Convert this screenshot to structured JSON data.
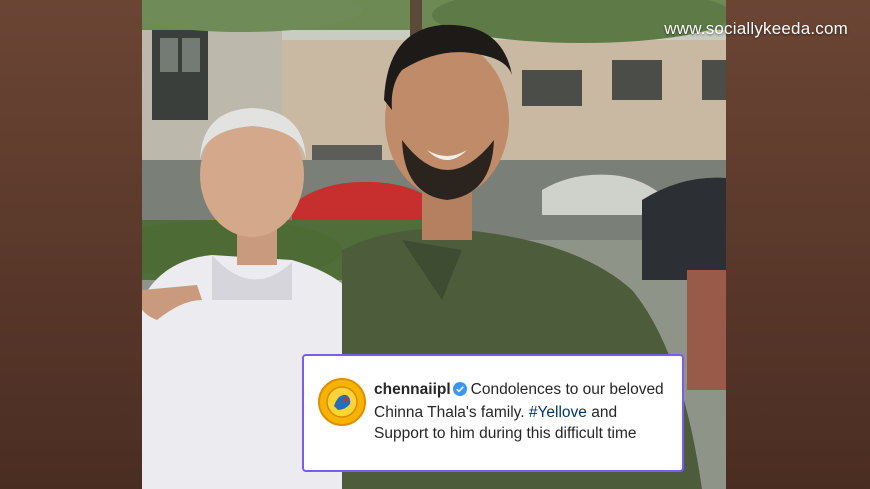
{
  "watermark": "www.sociallykeeda.com",
  "post": {
    "username": "chennaiipl",
    "caption_before": "Condolences to our beloved Chinna Thala's family.",
    "hashtag": "#Yellove",
    "caption_after": "and Support to him during this difficult time"
  },
  "icons": {
    "avatar": "chennai-super-kings-logo",
    "verified": "verified-badge-icon"
  },
  "colors": {
    "card_border": "#7b5cf0",
    "verified_blue": "#3897f0",
    "hashtag": "#00376b",
    "avatar_yellow": "#f6b400"
  }
}
